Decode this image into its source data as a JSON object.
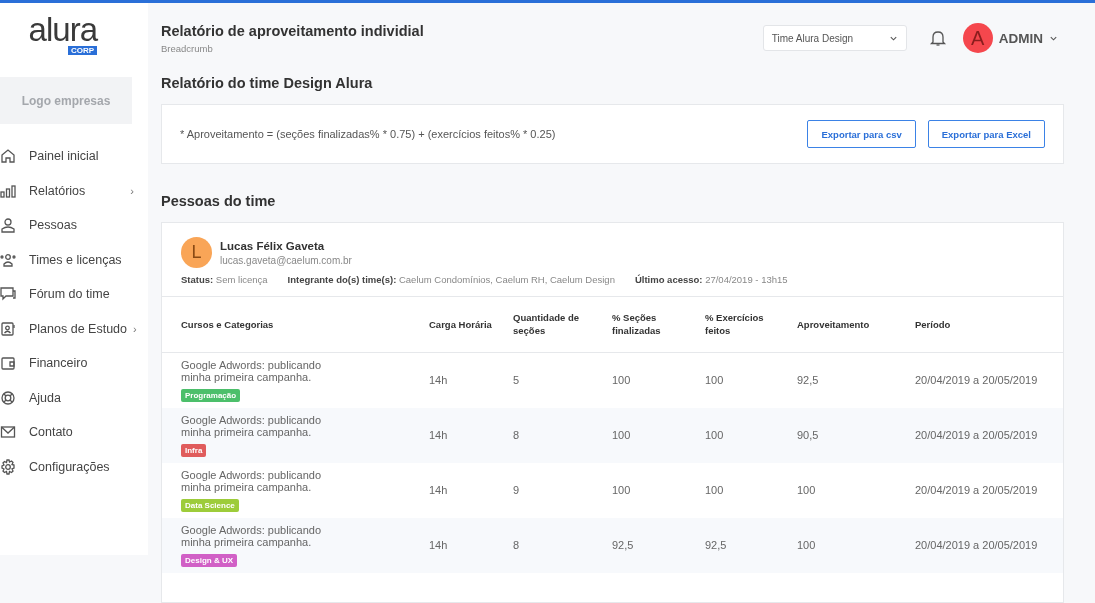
{
  "logo": {
    "wordmark": "alura",
    "badge": "CORP"
  },
  "company_logo": "Logo empresas",
  "sidebar": {
    "items": [
      {
        "label": "Painel inicial"
      },
      {
        "label": "Relatórios",
        "arrow": "›"
      },
      {
        "label": "Pessoas"
      },
      {
        "label": "Times e licenças"
      },
      {
        "label": "Fórum do time"
      },
      {
        "label": "Planos de Estudo",
        "arrow": "›"
      },
      {
        "label": "Financeiro"
      },
      {
        "label": "Ajuda"
      },
      {
        "label": "Contato"
      },
      {
        "label": "Configurações"
      }
    ]
  },
  "header": {
    "title": "Relatório de aproveitamento individial",
    "breadcrumb": "Breadcrumb",
    "team_select": "Time Alura Design",
    "user": {
      "initial": "A",
      "name": "ADMIN"
    }
  },
  "section_title": "Relatório do time Design Alura",
  "formula": "* Aproveitamento = (seções finalizadas% * 0.75) + (exercícios feitos% * 0.25)",
  "buttons": [
    "Exportar para csv",
    "Exportar para Excel"
  ],
  "people_title": "Pessoas do time",
  "person": {
    "initial": "L",
    "name": "Lucas Félix Gaveta",
    "email": "lucas.gaveta@caelum.com.br",
    "details": [
      {
        "label": "Status:",
        "value": "Sem licença"
      },
      {
        "label": "Integrante do(s)  time(s):",
        "value": "Caelum Condomínios, Caelum RH, Caelum Design"
      },
      {
        "label": "Último acesso:",
        "value": "27/04/2019 - 13h15"
      }
    ]
  },
  "table": {
    "columns": [
      "Cursos e Categorias",
      "Carga Horária",
      "Quantidade de seções",
      "% Seções finalizadas",
      "% Exercícios feitos",
      "Aproveitamento",
      "Período"
    ],
    "rows": [
      {
        "tag": "Programação",
        "color": "#4cbf6b",
        "cells": [
          "Google Adwords: publicando minha primeira campanha.",
          "14h",
          "5",
          "100",
          "100",
          "92,5",
          "20/04/2019 a 20/05/2019"
        ]
      },
      {
        "tag": "Infra",
        "color": "#e05c5c",
        "cells": [
          "Google Adwords: publicando minha primeira campanha.",
          "14h",
          "8",
          "100",
          "100",
          "90,5",
          "20/04/2019 a 20/05/2019"
        ]
      },
      {
        "tag": "Data Science",
        "color": "#9dcc3a",
        "cells": [
          "Google Adwords: publicando minha primeira campanha.",
          "14h",
          "9",
          "100",
          "100",
          "100",
          "20/04/2019 a 20/05/2019"
        ]
      },
      {
        "tag": "Design & UX",
        "color": "#d160c6",
        "cells": [
          "Google Adwords: publicando minha primeira campanha.",
          "14h",
          "8",
          "92,5",
          "92,5",
          "100",
          "20/04/2019 a 20/05/2019"
        ]
      }
    ]
  }
}
